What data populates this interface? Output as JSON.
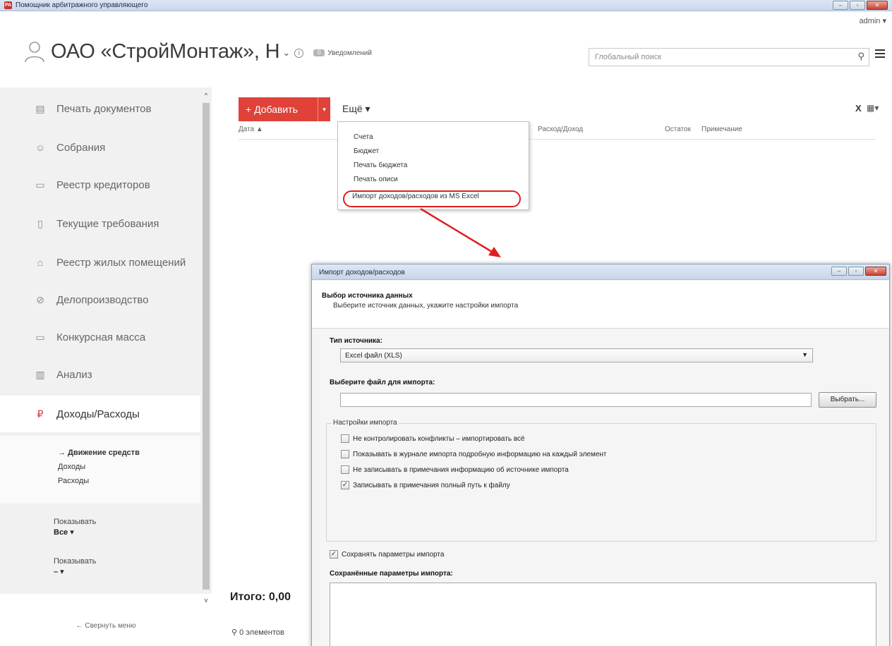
{
  "window": {
    "title": "Помощник арбитражного управляющего",
    "app_icon": "РА"
  },
  "header": {
    "user": "admin ▾",
    "org_title": "ОАО «СтройМонтаж», Н",
    "notifications_count": "0",
    "notifications_label": "Уведомлений",
    "search_placeholder": "Глобальный поиск"
  },
  "sidebar": {
    "items": [
      {
        "label": "Печать документов",
        "icon": "document-icon"
      },
      {
        "label": "Собрания",
        "icon": "meeting-icon"
      },
      {
        "label": "Реестр кредиторов",
        "icon": "registry-icon"
      },
      {
        "label": "Текущие требования",
        "icon": "clipboard-icon"
      },
      {
        "label": "Реестр жилых помещений",
        "icon": "house-icon"
      },
      {
        "label": "Делопроизводство",
        "icon": "paperclip-icon"
      },
      {
        "label": "Конкурсная масса",
        "icon": "box-icon"
      },
      {
        "label": "Анализ",
        "icon": "bar-chart-icon"
      },
      {
        "label": "Доходы/Расходы",
        "icon": "ruble-icon"
      }
    ],
    "subnav": [
      "→ Движение средств",
      "Доходы",
      "Расходы"
    ],
    "filter1": {
      "label": "Показывать",
      "value": "Все ▾"
    },
    "filter2": {
      "label": "Показывать",
      "value": "– ▾"
    },
    "collapse_label": "←  Свернуть меню"
  },
  "toolbar": {
    "add_label": "+ Добавить",
    "add_split": "▾",
    "more_label": "Ещё ▾",
    "clear_label": "X",
    "columns_label": "▦▾"
  },
  "table": {
    "columns": [
      "Дата ▲",
      "Расход/Доход",
      "Остаток",
      "Примечание"
    ]
  },
  "dropdown": {
    "items": [
      "Счета",
      "Бюджет",
      "Печать бюджета",
      "Печать описи",
      "Импорт доходов/расходов из MS Excel"
    ]
  },
  "footer": {
    "total": "Итого:  0,00",
    "count": "0 элементов"
  },
  "dialog": {
    "title": "Импорт доходов/расходов",
    "heading": "Выбор источника данных",
    "subheading": "Выберите источник данных, укажите настройки импорта",
    "source_type_label": "Тип источника:",
    "source_type_value": "Excel файл (XLS)",
    "file_label": "Выберите файл для импорта:",
    "browse_label": "Выбрать...",
    "settings_group_label": "Настройки импорта",
    "options": [
      {
        "label": "Не контролировать конфликты – импортировать всё",
        "checked": false
      },
      {
        "label": "Показывать в журнале импорта подробную информацию на каждый элемент",
        "checked": false
      },
      {
        "label": "Не записывать в примечания информацию об источнике импорта",
        "checked": false
      },
      {
        "label": "Записывать в примечания полный путь к файлу",
        "checked": true
      }
    ],
    "save_params": {
      "label": "Сохранять параметры импорта",
      "checked": true
    },
    "saved_params_label": "Сохранённые параметры импорта:"
  },
  "colors": {
    "accent_red": "#e0423a",
    "highlight_ring": "#e01e1e",
    "arrow": "#e01e1e"
  }
}
